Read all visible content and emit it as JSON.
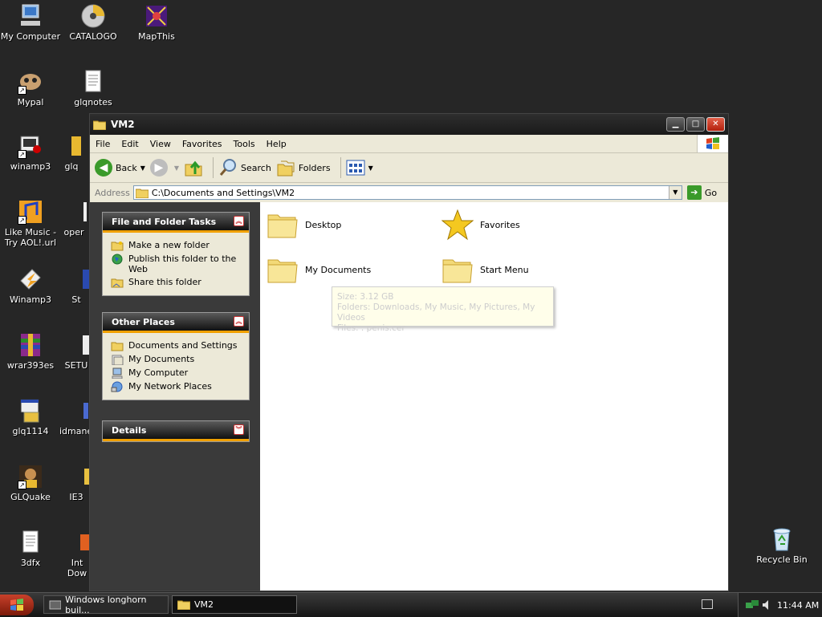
{
  "desktop": {
    "icons": [
      {
        "label": "My Computer"
      },
      {
        "label": "CATALOGO"
      },
      {
        "label": "MapThis"
      },
      {
        "label": "Mypal"
      },
      {
        "label": "glqnotes"
      },
      {
        "label": "winamp3"
      },
      {
        "label": "glq"
      },
      {
        "label": "Like Music - Try AOL!.url"
      },
      {
        "label": "oper"
      },
      {
        "label": "Winamp3"
      },
      {
        "label": "St"
      },
      {
        "label": "wrar393es"
      },
      {
        "label": "SETU"
      },
      {
        "label": "glq1114"
      },
      {
        "label": "idmane"
      },
      {
        "label": "GLQuake"
      },
      {
        "label": "IE3"
      },
      {
        "label": "3dfx"
      },
      {
        "label": "Int Dow"
      },
      {
        "label": "Recycle Bin"
      }
    ]
  },
  "window": {
    "title": "VM2",
    "menu": [
      "File",
      "Edit",
      "View",
      "Favorites",
      "Tools",
      "Help"
    ],
    "toolbar": {
      "back": "Back",
      "search": "Search",
      "folders": "Folders"
    },
    "address": {
      "label": "Address",
      "value": "C:\\Documents and Settings\\VM2",
      "go": "Go"
    },
    "panels": {
      "file_tasks": {
        "title": "File and Folder Tasks",
        "items": [
          "Make a new folder",
          "Publish this folder to the Web",
          "Share this folder"
        ]
      },
      "other_places": {
        "title": "Other Places",
        "items": [
          "Documents and Settings",
          "My Documents",
          "My Computer",
          "My Network Places"
        ]
      },
      "details": {
        "title": "Details"
      }
    },
    "folders": [
      "Desktop",
      "Favorites",
      "My Documents",
      "Start Menu"
    ],
    "tooltip": {
      "size": "Size: 3.12 GB",
      "folders": "Folders: Downloads, My Music, My Pictures, My Videos",
      "files": "Files: . penis.cer"
    }
  },
  "taskbar": {
    "tasks": [
      "Windows longhorn buil...",
      "VM2"
    ],
    "clock": "11:44 AM"
  },
  "colors": {
    "accent": "#f0a000",
    "desktop": "#262626"
  }
}
